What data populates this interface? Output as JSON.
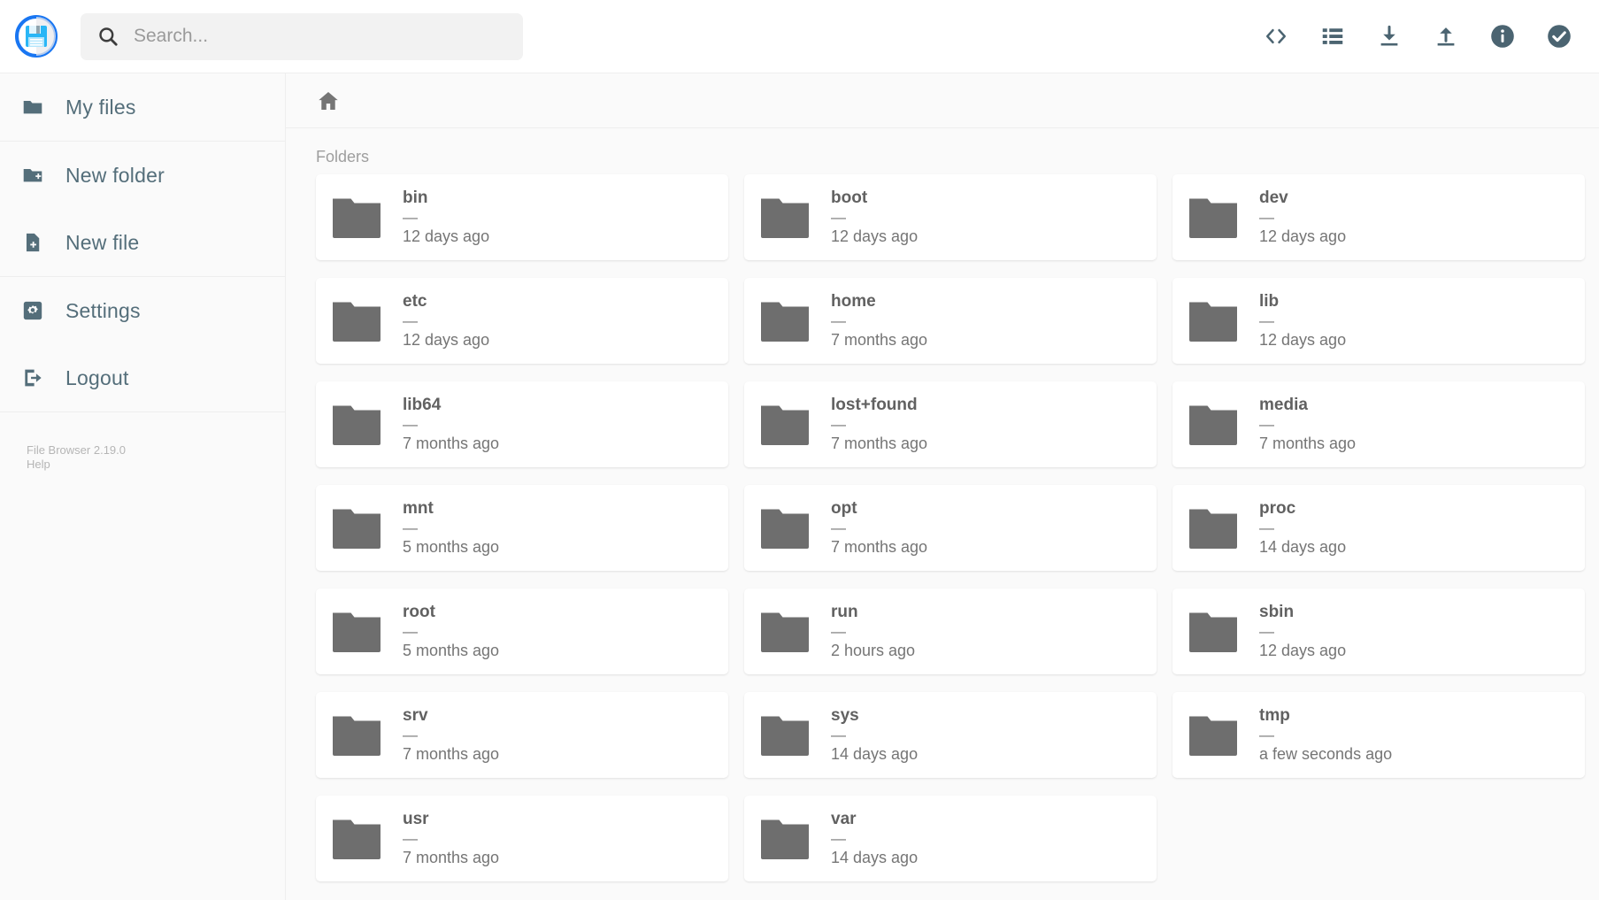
{
  "header": {
    "logo_icon": "floppy-disk-save-icon",
    "search": {
      "icon": "search-icon",
      "value": "",
      "placeholder": "Search..."
    },
    "actions": [
      {
        "name": "code-brackets-icon",
        "label": "<>"
      },
      {
        "name": "list-view-icon",
        "label": "List view"
      },
      {
        "name": "download-icon",
        "label": "Download"
      },
      {
        "name": "upload-icon",
        "label": "Upload"
      },
      {
        "name": "info-icon",
        "label": "Info"
      },
      {
        "name": "select-all-check-icon",
        "label": "Select"
      }
    ]
  },
  "sidebar": {
    "groups": [
      {
        "items": [
          {
            "icon": "folder-icon",
            "label": "My files"
          }
        ]
      },
      {
        "items": [
          {
            "icon": "folder-plus-icon",
            "label": "New folder"
          },
          {
            "icon": "file-plus-icon",
            "label": "New file"
          }
        ]
      },
      {
        "items": [
          {
            "icon": "gear-icon",
            "label": "Settings"
          },
          {
            "icon": "logout-icon",
            "label": "Logout"
          }
        ]
      }
    ],
    "footer": {
      "version": "File Browser 2.19.0",
      "help": "Help"
    }
  },
  "main": {
    "breadcrumb": {
      "home_icon": "home-icon"
    },
    "section_title": "Folders",
    "size_placeholder": "—",
    "folders": [
      {
        "name": "bin",
        "size": "—",
        "modified": "12 days ago"
      },
      {
        "name": "boot",
        "size": "—",
        "modified": "12 days ago"
      },
      {
        "name": "dev",
        "size": "—",
        "modified": "12 days ago"
      },
      {
        "name": "etc",
        "size": "—",
        "modified": "12 days ago"
      },
      {
        "name": "home",
        "size": "—",
        "modified": "7 months ago"
      },
      {
        "name": "lib",
        "size": "—",
        "modified": "12 days ago"
      },
      {
        "name": "lib64",
        "size": "—",
        "modified": "7 months ago"
      },
      {
        "name": "lost+found",
        "size": "—",
        "modified": "7 months ago"
      },
      {
        "name": "media",
        "size": "—",
        "modified": "7 months ago"
      },
      {
        "name": "mnt",
        "size": "—",
        "modified": "5 months ago"
      },
      {
        "name": "opt",
        "size": "—",
        "modified": "7 months ago"
      },
      {
        "name": "proc",
        "size": "—",
        "modified": "14 days ago"
      },
      {
        "name": "root",
        "size": "—",
        "modified": "5 months ago"
      },
      {
        "name": "run",
        "size": "—",
        "modified": "2 hours ago"
      },
      {
        "name": "sbin",
        "size": "—",
        "modified": "12 days ago"
      },
      {
        "name": "srv",
        "size": "—",
        "modified": "7 months ago"
      },
      {
        "name": "sys",
        "size": "—",
        "modified": "14 days ago"
      },
      {
        "name": "tmp",
        "size": "—",
        "modified": "a few seconds ago"
      },
      {
        "name": "usr",
        "size": "—",
        "modified": "7 months ago"
      },
      {
        "name": "var",
        "size": "—",
        "modified": "14 days ago"
      }
    ]
  },
  "colors": {
    "accent": "#2196f3",
    "icon_slate": "#4b6471",
    "sidebar_text": "#546e7a",
    "folder_gray": "#6e6e6e",
    "page_bg": "#fafafa",
    "card_bg": "#ffffff",
    "muted_text": "#9e9e9e"
  }
}
